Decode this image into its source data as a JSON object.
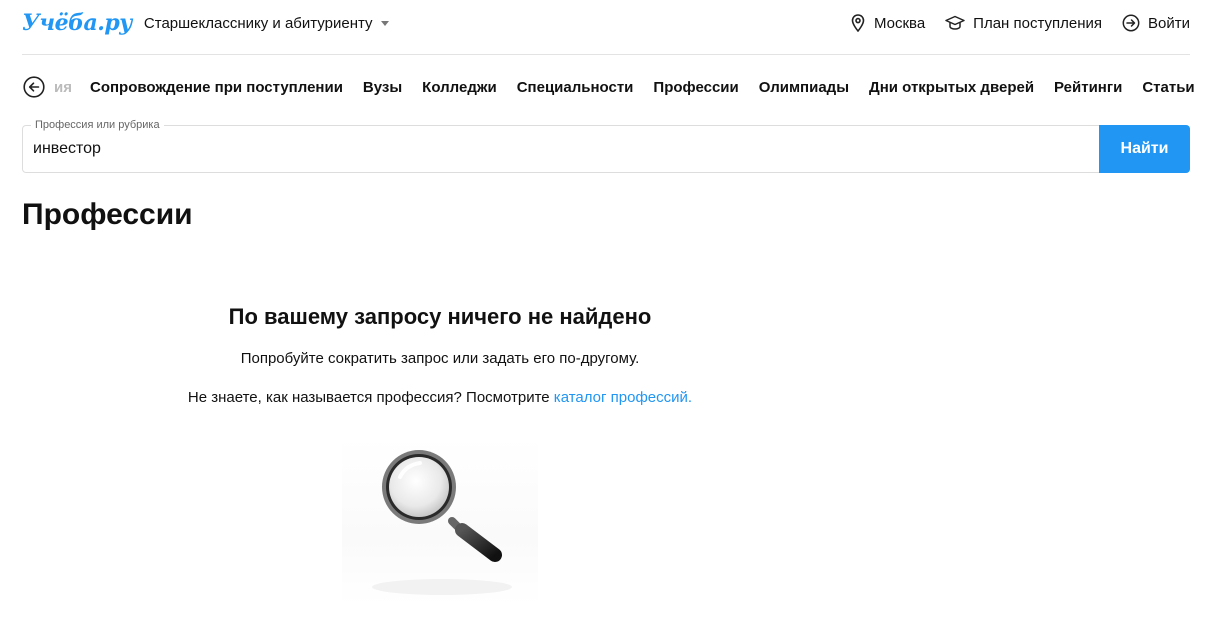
{
  "header": {
    "logo": "Учёба.ру",
    "audience": "Старшекласснику и абитуриенту",
    "city": "Москва",
    "plan": "План поступления",
    "login": "Войти"
  },
  "nav": {
    "faded": "ия",
    "items": [
      "Сопровождение при поступлении",
      "Вузы",
      "Колледжи",
      "Специальности",
      "Профессии",
      "Олимпиады",
      "Дни открытых дверей",
      "Рейтинги",
      "Статьи"
    ]
  },
  "search": {
    "label": "Профессия или рубрика",
    "value": "инвестор",
    "button": "Найти"
  },
  "page_title": "Профессии",
  "empty": {
    "title": "По вашему запросу ничего не найдено",
    "hint": "Попробуйте сократить запрос или задать его по-другому.",
    "catalog_prefix": "Не знаете, как называется профессия? Посмотрите ",
    "catalog_link": "каталог профессий."
  },
  "colors": {
    "accent": "#2196f3",
    "text": "#111111"
  }
}
